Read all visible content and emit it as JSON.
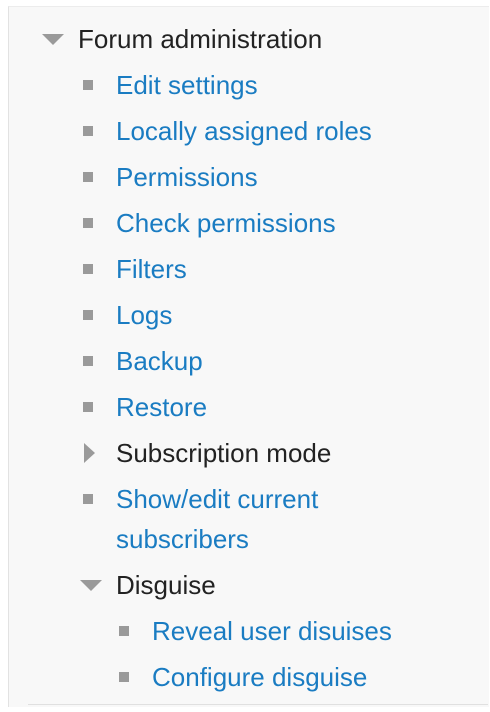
{
  "colors": {
    "link": "#1a7cc2",
    "text": "#222222",
    "icon": "#9a9a9a",
    "panel_bg": "#f8f8f8"
  },
  "admin": {
    "title": "Forum administration",
    "toggle_icon": "triangle-down-icon",
    "items": [
      {
        "label": "Edit settings",
        "icon": "square-bullet-icon"
      },
      {
        "label": "Locally assigned roles",
        "icon": "square-bullet-icon"
      },
      {
        "label": "Permissions",
        "icon": "square-bullet-icon"
      },
      {
        "label": "Check permissions",
        "icon": "square-bullet-icon"
      },
      {
        "label": "Filters",
        "icon": "square-bullet-icon"
      },
      {
        "label": "Logs",
        "icon": "square-bullet-icon"
      },
      {
        "label": "Backup",
        "icon": "square-bullet-icon"
      },
      {
        "label": "Restore",
        "icon": "square-bullet-icon"
      }
    ],
    "subscription_mode": {
      "label": "Subscription mode",
      "icon": "triangle-right-icon"
    },
    "show_edit_subscribers": {
      "line1": "Show/edit current",
      "line2": "subscribers",
      "icon": "square-bullet-icon"
    },
    "disguise": {
      "label": "Disguise",
      "icon": "triangle-down-icon",
      "items": [
        {
          "label": "Reveal user disuises",
          "icon": "square-bullet-icon"
        },
        {
          "label": "Configure disguise",
          "icon": "square-bullet-icon"
        }
      ]
    }
  }
}
